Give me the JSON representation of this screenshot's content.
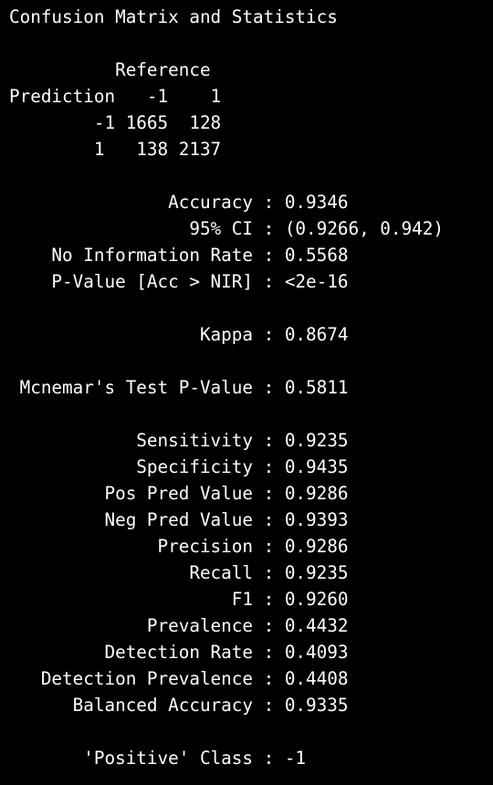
{
  "console": {
    "lines": [
      "Confusion Matrix and Statistics",
      "",
      "          Reference",
      "Prediction   -1    1",
      "        -1 1665  128",
      "        1   138 2137",
      "",
      "               Accuracy : 0.9346",
      "                 95% CI : (0.9266, 0.942)",
      "    No Information Rate : 0.5568",
      "    P-Value [Acc > NIR] : <2e-16",
      "",
      "                  Kappa : 0.8674",
      "",
      " Mcnemar's Test P-Value : 0.5811",
      "",
      "            Sensitivity : 0.9235",
      "            Specificity : 0.9435",
      "         Pos Pred Value : 0.9286",
      "         Neg Pred Value : 0.9393",
      "              Precision : 0.9286",
      "                 Recall : 0.9235",
      "                     F1 : 0.9260",
      "             Prevalence : 0.4432",
      "         Detection Rate : 0.4093",
      "   Detection Prevalence : 0.4408",
      "      Balanced Accuracy : 0.9335",
      "",
      "       'Positive' Class : -1"
    ]
  }
}
